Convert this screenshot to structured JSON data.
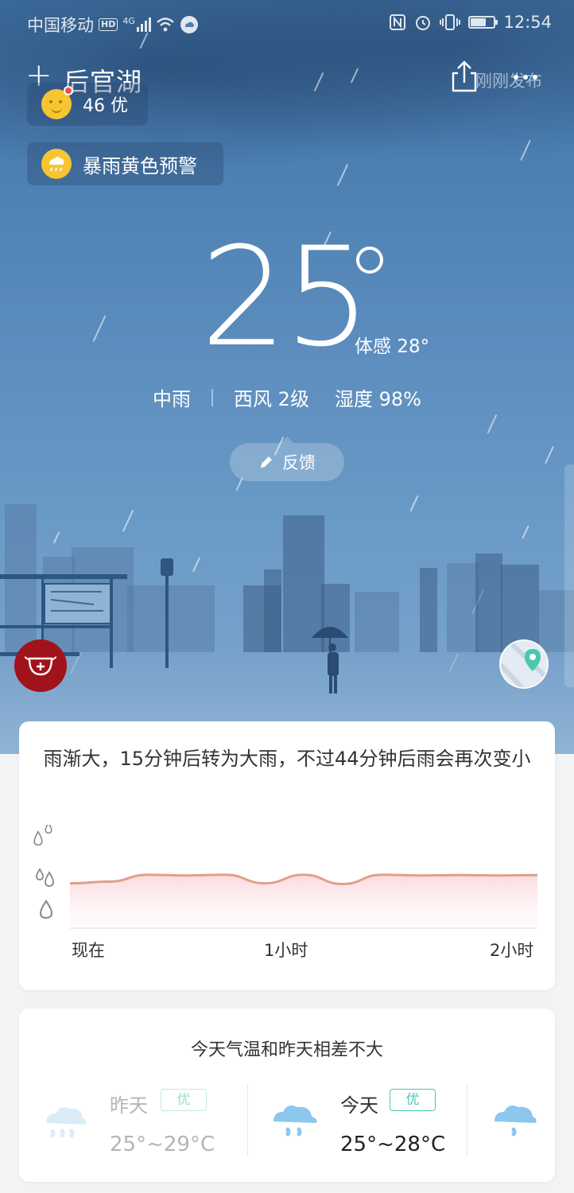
{
  "status_bar": {
    "carrier": "中国移动",
    "hd": "HD",
    "network": "4G",
    "time": "12:54"
  },
  "header": {
    "add_icon": "+",
    "city": "后官湖",
    "publish_time": "刚刚发布"
  },
  "aqi": {
    "value": "46 优"
  },
  "warning": {
    "label": "暴雨黄色预警"
  },
  "current": {
    "temperature": "25",
    "feels_like": "体感 28°",
    "condition": "中雨",
    "wind": "西风 2级",
    "humidity": "湿度 98%"
  },
  "feedback": {
    "label": "反馈"
  },
  "nowcast": {
    "summary": "雨渐大，15分钟后转为大雨，不过44分钟后雨会再次变小",
    "x_ticks": [
      "现在",
      "1小时",
      "2小时"
    ]
  },
  "chart_data": {
    "type": "area",
    "xlabel": "",
    "ylabel": "",
    "x": [
      0,
      10,
      20,
      30,
      40,
      50,
      60,
      70,
      80,
      90,
      100,
      110,
      120
    ],
    "xlim": [
      0,
      120
    ],
    "ylim": [
      0,
      3
    ],
    "series": [
      {
        "values": [
          1.3,
          1.35,
          1.55,
          1.53,
          1.55,
          1.3,
          1.55,
          1.28,
          1.55,
          1.53,
          1.54,
          1.53,
          1.54
        ]
      }
    ],
    "colors": {
      "line": "#e0a08a",
      "fill": "#fbe3e6"
    }
  },
  "comparison": {
    "title": "今天气温和昨天相差不大",
    "yesterday": {
      "label": "昨天",
      "aqi": "优",
      "range": "25°~29°C"
    },
    "today": {
      "label": "今天",
      "aqi": "优",
      "range": "25°~28°C"
    }
  },
  "colors": {
    "accent_green": "#4dc6b0",
    "warning_yellow": "#f7c531",
    "mask_red": "#a1131a"
  }
}
